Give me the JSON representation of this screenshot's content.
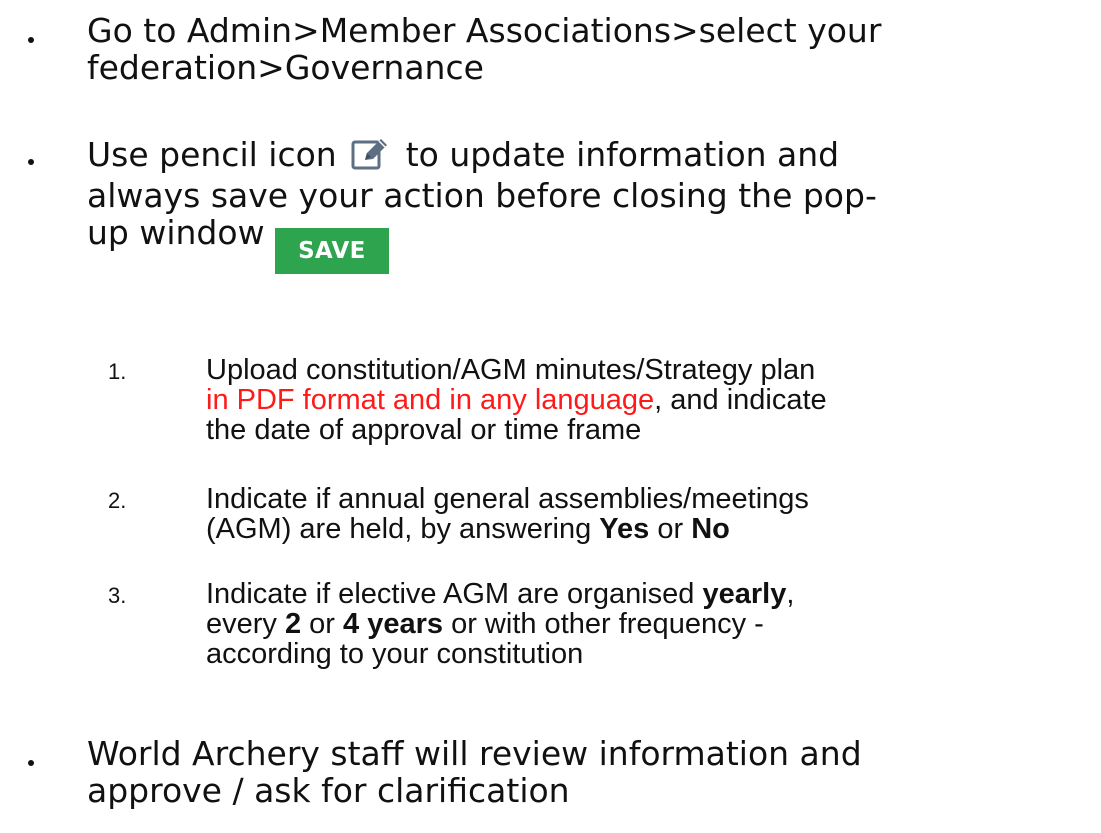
{
  "bullets": [
    {
      "lines": [
        "Go to Admin>Member Associations>select your",
        "federation>Governance"
      ]
    },
    {
      "line1_before_icon": "Use pencil icon",
      "line1_after_icon": "to update information and",
      "line2": "always save your action before closing the pop-",
      "line3": "up window",
      "save_label": "SAVE"
    },
    {
      "lines": [
        "World Archery staff will review information and",
        "approve / ask for clarification"
      ]
    }
  ],
  "steps": [
    {
      "number": "1.",
      "line1": "Upload constitution/AGM minutes/Strategy plan",
      "line2_red": "in PDF format and in any language",
      "line2_rest": ", and indicate",
      "line3": "the date of approval or time frame"
    },
    {
      "number": "2.",
      "line1": "Indicate if annual general assemblies/meetings",
      "line2_a": "(AGM) are held, by answering ",
      "line2_yes": "Yes",
      "line2_or": " or ",
      "line2_no": "No"
    },
    {
      "number": "3.",
      "line1_a": "Indicate if elective AGM are organised ",
      "line1_yearly": "yearly",
      "line1_comma": ",",
      "line2_a": "every ",
      "line2_two": "2",
      "line2_or": " or ",
      "line2_four": "4 years",
      "line2_rest": " or with other frequency -",
      "line3": "according to your constitution"
    }
  ],
  "colors": {
    "text": "#111111",
    "highlight_red": "#ff1a1a",
    "save_green": "#2ea44f"
  },
  "icons": {
    "pencil": "edit-pencil-icon"
  }
}
